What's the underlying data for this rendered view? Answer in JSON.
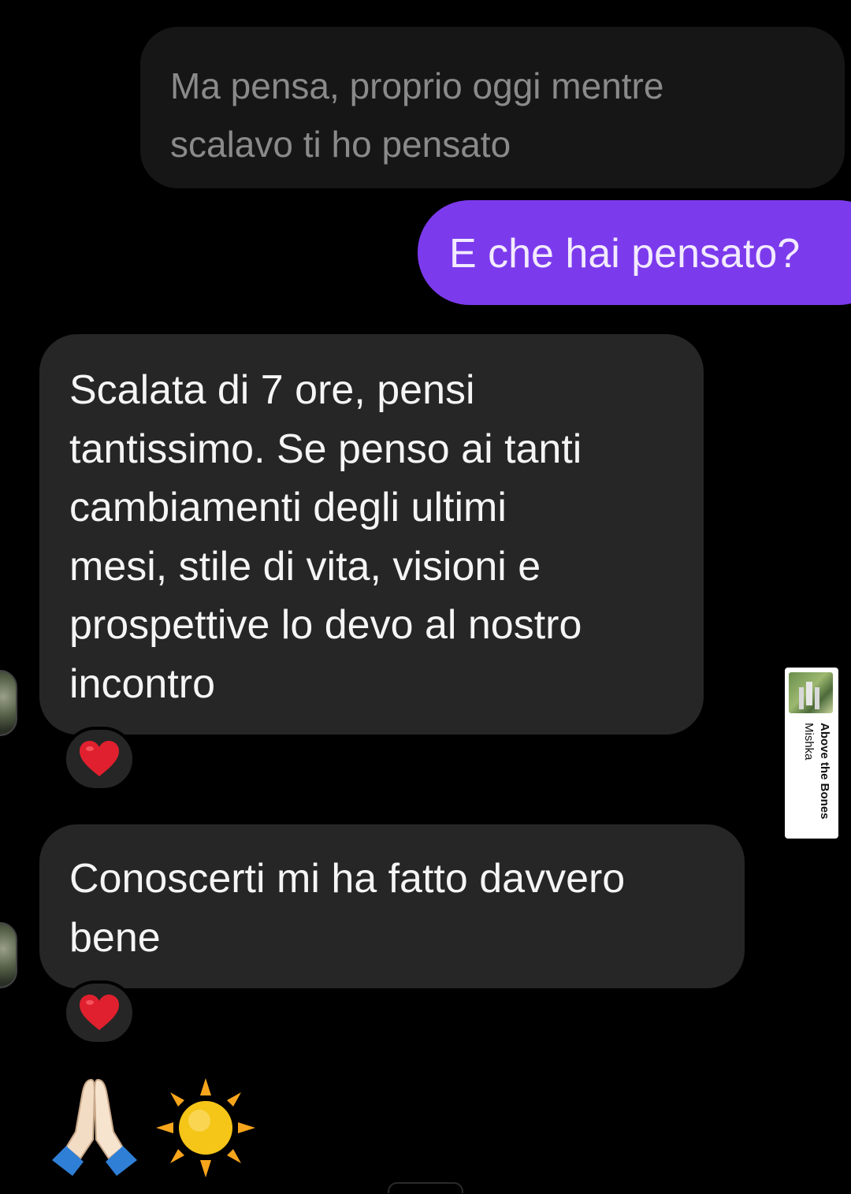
{
  "messages": [
    {
      "id": "m1",
      "direction": "received",
      "text": "Ma pensa, proprio oggi mentre\nscalavo ti ho pensato"
    },
    {
      "id": "m2",
      "direction": "sent",
      "text": "E che hai pensato?"
    },
    {
      "id": "m3",
      "direction": "received",
      "text": "Scalata di 7 ore, pensi\ntantissimo. Se penso ai tanti\ncambiamenti degli ultimi\nmesi, stile di vita, visioni e\nprospettive lo devo al nostro\nincontro",
      "reaction": "heart-icon"
    },
    {
      "id": "m4",
      "direction": "received",
      "text": "Conoscerti mi ha fatto davvero\nbene",
      "reaction": "heart-icon"
    }
  ],
  "emoji_message": [
    "pray-icon",
    "sun-icon"
  ],
  "music_sticker": {
    "title": "Above the Bones",
    "artist": "Mishka"
  },
  "colors": {
    "background": "#000000",
    "received_bubble": "#262626",
    "sent_bubble": "#7c3aed",
    "heart": "#e0202e"
  }
}
